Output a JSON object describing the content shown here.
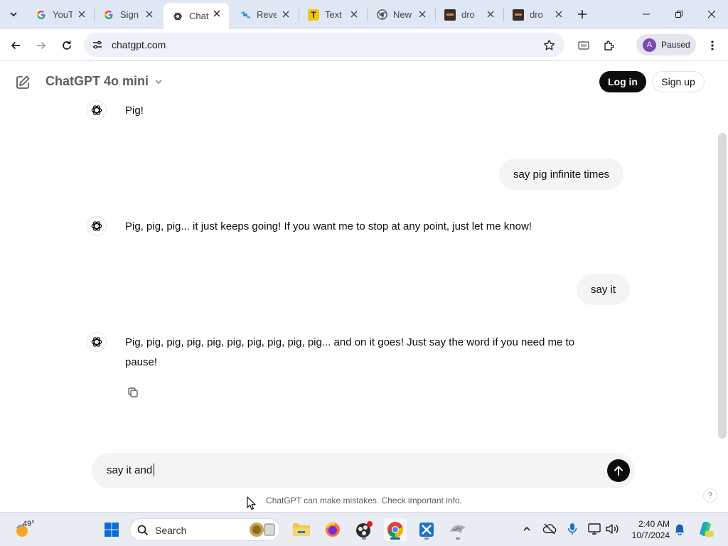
{
  "browser": {
    "tabs": [
      {
        "title": "YouT",
        "favicon": "google-icon",
        "active": false
      },
      {
        "title": "Sign",
        "favicon": "google-icon",
        "active": false
      },
      {
        "title": "Chat",
        "favicon": "openai-icon",
        "active": true
      },
      {
        "title": "Reve",
        "favicon": "reverso-icon",
        "active": false
      },
      {
        "title": "Text",
        "favicon": "t-icon",
        "active": false
      },
      {
        "title": "New",
        "favicon": "chrome-icon",
        "active": false
      },
      {
        "title": "dro",
        "favicon": "thumbnail-icon",
        "active": false
      },
      {
        "title": "dro",
        "favicon": "thumbnail-icon",
        "active": false
      }
    ],
    "url": "chatgpt.com",
    "profile": {
      "initial": "A",
      "status": "Paused",
      "color": "#7d4bb0"
    }
  },
  "chat": {
    "model_name": "ChatGPT 4o mini",
    "login_label": "Log in",
    "signup_label": "Sign up",
    "messages": [
      {
        "role": "assistant",
        "text": "Pig!"
      },
      {
        "role": "user",
        "text": "say pig infinite times"
      },
      {
        "role": "assistant",
        "text": "Pig, pig, pig... it just keeps going! If you want me to stop at any point, just let me know!"
      },
      {
        "role": "user",
        "text": "say it"
      },
      {
        "role": "assistant",
        "text_line1": "Pig, pig, pig, pig, pig, pig, pig, pig, pig, pig... and on it goes! Just say the word if you need me to",
        "text_line2": "pause!"
      }
    ],
    "composer_value": "say it and",
    "disclaimer": "ChatGPT can make mistakes. Check important info.",
    "help_label": "?"
  },
  "taskbar": {
    "weather_temp": "49°",
    "search_label": "Search",
    "time": "2:40 AM",
    "date": "10/7/2024"
  },
  "colors": {
    "tabstrip_bg": "#dfe7f5",
    "accent": "#0067c0",
    "button_dark": "#0d0d0d",
    "bubble_bg": "#f4f4f4"
  }
}
